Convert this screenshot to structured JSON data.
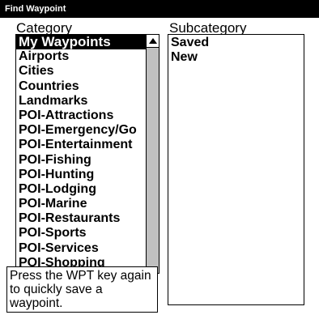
{
  "window": {
    "title": "Find Waypoint"
  },
  "category": {
    "label": "Category",
    "items": [
      {
        "label": "My Waypoints",
        "selected": true
      },
      {
        "label": "Airports"
      },
      {
        "label": "Cities"
      },
      {
        "label": "Countries"
      },
      {
        "label": "Landmarks"
      },
      {
        "label": "POI-Attractions"
      },
      {
        "label": "POI-Emergency/Go"
      },
      {
        "label": "POI-Entertainment"
      },
      {
        "label": "POI-Fishing"
      },
      {
        "label": "POI-Hunting"
      },
      {
        "label": "POI-Lodging"
      },
      {
        "label": "POI-Marine"
      },
      {
        "label": "POI-Restaurants"
      },
      {
        "label": "POI-Sports"
      },
      {
        "label": "POI-Services"
      },
      {
        "label": "POI-Shopping"
      }
    ]
  },
  "subcategory": {
    "label": "Subcategory",
    "items": [
      {
        "label": "Saved"
      },
      {
        "label": "New"
      }
    ]
  },
  "help": {
    "text": "Press the WPT key again to quickly save a waypoint."
  },
  "icons": {
    "scroll_up": "scroll-up-arrow-icon"
  }
}
